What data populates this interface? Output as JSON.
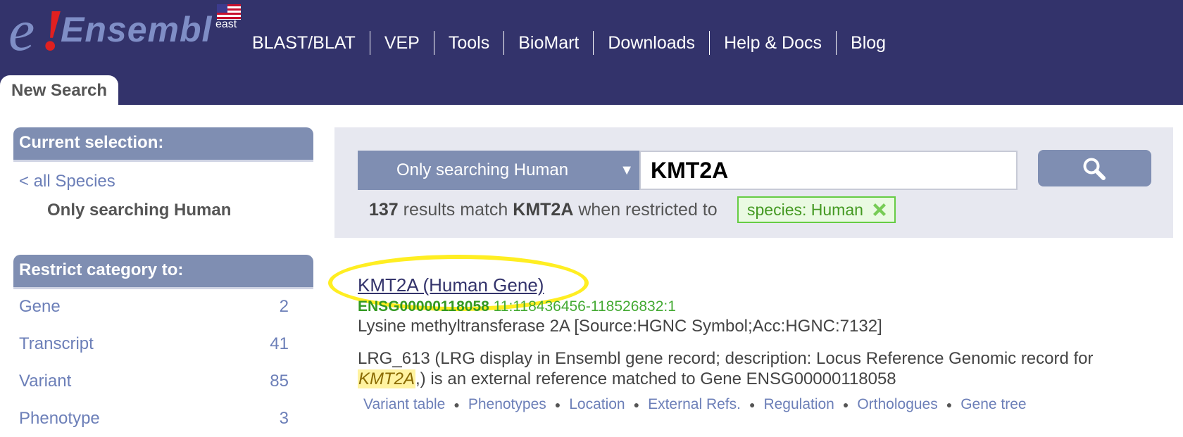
{
  "brand": {
    "logo_e": "e",
    "logo_bang": "!",
    "logo_word": "Ensembl",
    "region": "east"
  },
  "nav": [
    "BLAST/BLAT",
    "VEP",
    "Tools",
    "BioMart",
    "Downloads",
    "Help & Docs",
    "Blog"
  ],
  "tab": "New Search",
  "sidebar": {
    "current_selection_title": "Current selection:",
    "all_species_link": "< all Species",
    "only_searching": "Only searching Human",
    "restrict_title": "Restrict category to:",
    "categories": [
      {
        "label": "Gene",
        "count": "2"
      },
      {
        "label": "Transcript",
        "count": "41"
      },
      {
        "label": "Variant",
        "count": "85"
      },
      {
        "label": "Phenotype",
        "count": "3"
      }
    ]
  },
  "search": {
    "species_select": "Only searching Human",
    "arrow": "▼",
    "query": "KMT2A",
    "results_count": "137",
    "results_text_1": " results match ",
    "results_term": "KMT2A",
    "results_text_2": " when restricted to",
    "filter_chip": "species: Human"
  },
  "result": {
    "title": "KMT2A (Human Gene)",
    "stable_id": "ENSG00000118058",
    "location": "11:118436456-118526832:1",
    "description": "Lysine methyltransferase 2A [Source:HGNC Symbol;Acc:HGNC:7132]",
    "lrg_text_1": "LRG_613 (LRG display in Ensembl gene record; description: Locus Reference Genomic record for ",
    "lrg_highlight": "KMT2A",
    "lrg_text_2": ",) is an external reference matched to Gene ENSG00000118058",
    "sublinks": [
      "Variant table",
      "Phenotypes",
      "Location",
      "External Refs.",
      "Regulation",
      "Orthologues",
      "Gene tree"
    ]
  },
  "colors": {
    "masthead": "#33336b",
    "panel": "#7f8eb2",
    "link": "#6c7fb8",
    "highlight_ring": "#ffee22",
    "chip_border": "#66cc44"
  }
}
